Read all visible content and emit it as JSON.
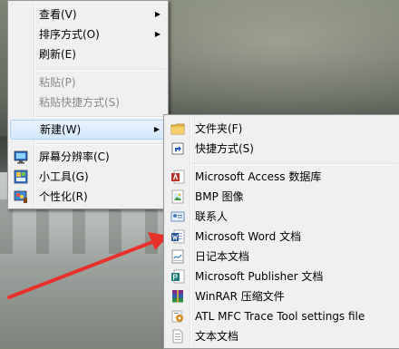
{
  "context_menu": {
    "items": [
      {
        "label": "查看(V)",
        "has_submenu": true
      },
      {
        "label": "排序方式(O)",
        "has_submenu": true
      },
      {
        "label": "刷新(E)"
      },
      {
        "label": "粘贴(P)",
        "disabled": true
      },
      {
        "label": "粘贴快捷方式(S)",
        "disabled": true
      },
      {
        "label": "新建(W)",
        "has_submenu": true,
        "highlighted": true
      },
      {
        "label": "屏幕分辨率(C)",
        "icon": "display-icon"
      },
      {
        "label": "小工具(G)",
        "icon": "gadgets-icon"
      },
      {
        "label": "个性化(R)",
        "icon": "personalize-icon"
      }
    ],
    "submenu_arrow": "▶"
  },
  "new_submenu": {
    "items": [
      {
        "label": "文件夹(F)",
        "icon": "folder-icon"
      },
      {
        "label": "快捷方式(S)",
        "icon": "shortcut-icon"
      },
      {
        "label": "Microsoft Access 数据库",
        "icon": "access-icon"
      },
      {
        "label": "BMP 图像",
        "icon": "bmp-image-icon"
      },
      {
        "label": "联系人",
        "icon": "contact-icon"
      },
      {
        "label": "Microsoft Word 文档",
        "icon": "word-icon"
      },
      {
        "label": "日记本文档",
        "icon": "journal-icon"
      },
      {
        "label": "Microsoft Publisher 文档",
        "icon": "publisher-icon"
      },
      {
        "label": "WinRAR 压缩文件",
        "icon": "winrar-icon"
      },
      {
        "label": "ATL MFC Trace Tool settings file",
        "icon": "settings-file-icon"
      },
      {
        "label": "文本文档",
        "icon": "text-document-icon"
      }
    ]
  },
  "annotation": {
    "arrow_color": "#e8312a"
  }
}
